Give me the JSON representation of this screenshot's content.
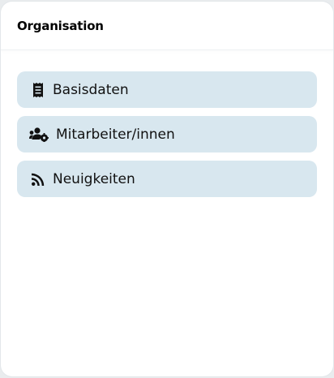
{
  "header": {
    "title": "Organisation"
  },
  "nav": {
    "items": [
      {
        "label": "Basisdaten",
        "icon": "receipt-icon"
      },
      {
        "label": "Mitarbeiter/innen",
        "icon": "users-gear-icon"
      },
      {
        "label": "Neuigkeiten",
        "icon": "rss-icon"
      }
    ]
  },
  "colors": {
    "item_background": "#d8e7ef",
    "card_background": "#ffffff",
    "page_background": "#e9ecee"
  }
}
